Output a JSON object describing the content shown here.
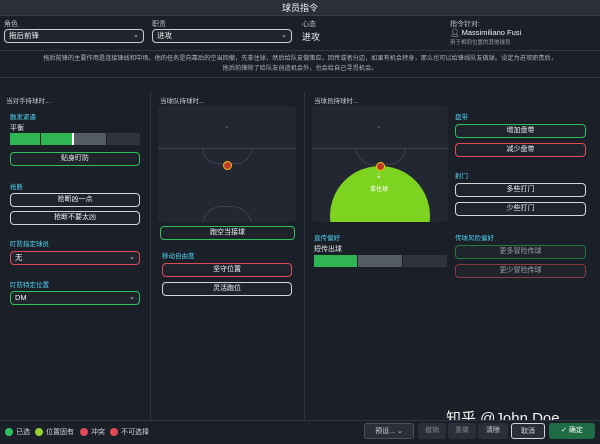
{
  "window": {
    "title": "球员指令"
  },
  "header": {
    "role_label": "角色",
    "role_value": "拖后前锋",
    "duty_label": "职责",
    "duty_value": "进攻",
    "mentality_label": "心态",
    "mentality_value": "进攻",
    "target_label": "指令针对:",
    "player_name": "Massimiliano Fusi",
    "player_sub": "用于相同位置的其他球员"
  },
  "description": {
    "line1": "拖后前锋的主要作用是连接锋线和中场。他的任务是向靠后的空当回撤，先拿住球，然后给队友做策应，回传或者分边，如果有机会转身，那么也可以给锋线队友做球。设定为进攻职责后，",
    "line2": "拖后前锋除了给队友创造机会外，也会给自己寻觅机会。"
  },
  "col1": {
    "title": "当对手持球时...",
    "press_title": "触发紧逼",
    "press_label": "平衡",
    "press_levels": 4,
    "press_selected": 2,
    "mark_button": "贴身盯防",
    "tackle_title": "抢断",
    "tackle_harder": "抢断凶一点",
    "tackle_easier": "抢断不要太凶",
    "mark_player_title": "盯防指定球员",
    "mark_player_value": "无",
    "mark_position_title": "盯防特定位置",
    "mark_position_value": "DM"
  },
  "col2": {
    "title": "当球队持球时...",
    "get_further_forward": "跑空当接球",
    "freedom_title": "移动自由度",
    "hold_position": "坚守位置",
    "roam": "灵活跑位"
  },
  "col3": {
    "title": "当球员持球时...",
    "hold_up_label": "拿住球",
    "cross_title": "直传偏好",
    "cross_label": "短传出球",
    "cross_levels": 3,
    "cross_selected": 1,
    "dribble_title": "盘带",
    "dribble_more": "增加盘带",
    "dribble_less": "减少盘带",
    "shoot_title": "射门",
    "shoot_more": "多些打门",
    "shoot_less": "少些打门",
    "risk_title": "传球风险偏好",
    "risk_more": "更多冒险传球",
    "risk_less": "更少冒险传球"
  },
  "footer": {
    "legend": [
      {
        "label": "已选",
        "color": "#2fbf5b"
      },
      {
        "label": "位置固有",
        "color": "#9acd32"
      },
      {
        "label": "冲突",
        "color": "#e04a57"
      },
      {
        "label": "不可选择",
        "color": "#e04a57"
      }
    ],
    "preset": "预设...",
    "undo": "撤销",
    "redo": "重做",
    "clear": "清除",
    "cancel": "取消",
    "confirm": "确定",
    "watermark": "知乎 @John Doe"
  }
}
